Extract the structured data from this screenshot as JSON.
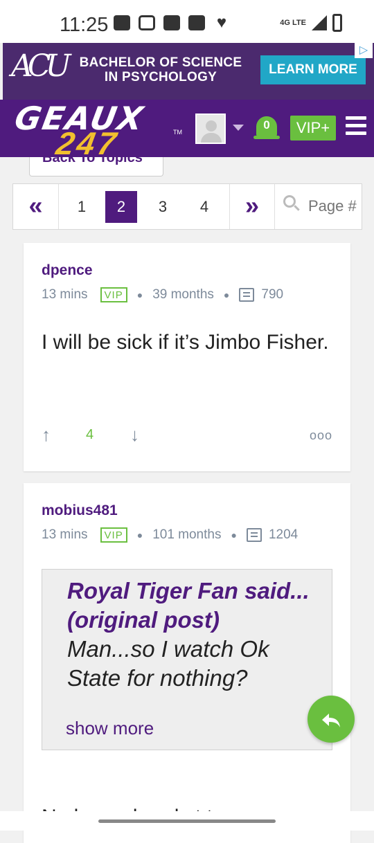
{
  "status": {
    "time": "11:25",
    "network": "4G LTE"
  },
  "ad": {
    "logo": "ACU",
    "text": "BACHELOR OF SCIENCE IN PSYCHOLOGY",
    "cta": "LEARN MORE",
    "flag": "▷"
  },
  "header": {
    "logo_top": "GEAUX",
    "logo_bottom": "247",
    "tm": "TM",
    "notifications": "0",
    "vip": "VIP+"
  },
  "back_button": "Back To Topics",
  "pagination": {
    "first": "«",
    "pages": [
      "1",
      "2",
      "3",
      "4"
    ],
    "active": "2",
    "last": "»",
    "placeholder": "Page #"
  },
  "posts": [
    {
      "username": "dpence",
      "time": "13 mins",
      "badge": "VIP",
      "tenure": "39 months",
      "post_count": "790",
      "body": "I will be sick if it’s Jimbo Fisher.",
      "votes": "4",
      "more": "ooo"
    },
    {
      "username": "mobius481",
      "time": "13 mins",
      "badge": "VIP",
      "tenure": "101 months",
      "post_count": "1204",
      "quote": {
        "author": "Royal Tiger Fan said...",
        "link": "(original post)",
        "text": "Man...so I watch Ok State for nothing?",
        "show_more": "show more"
      },
      "tail": "No born ahead st t"
    }
  ],
  "colors": {
    "brand_purple": "#4f1b7e",
    "accent_green": "#6abf3f",
    "ad_bg": "#4b2a6e",
    "ad_btn": "#21a7c7"
  }
}
